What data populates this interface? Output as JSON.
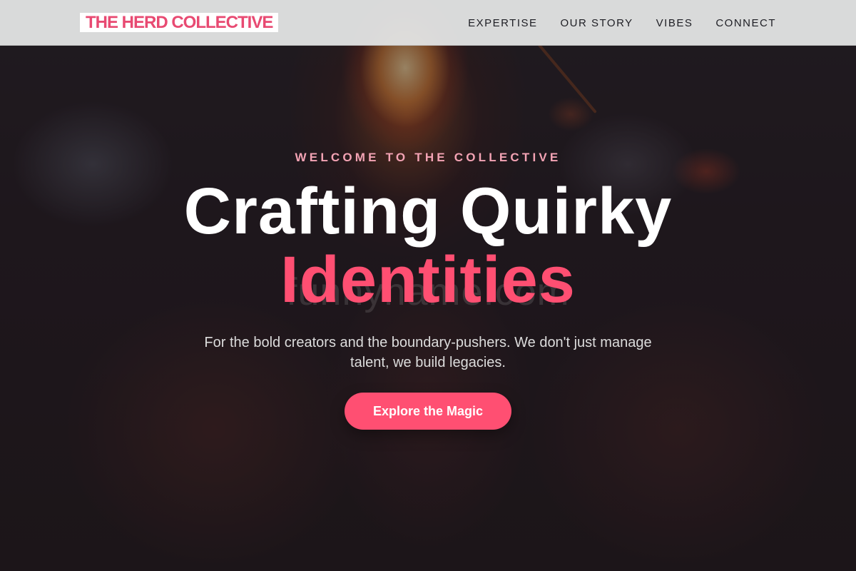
{
  "nav": {
    "logo": "THE HERD COLLECTIVE",
    "links": [
      "EXPERTISE",
      "OUR STORY",
      "VIBES",
      "CONNECT"
    ]
  },
  "hero": {
    "eyebrow": "WELCOME TO THE COLLECTIVE",
    "headline_line1": "Crafting Quirky",
    "headline_line2": "Identities",
    "subtext": "For the bold creators and the boundary-pushers. We don't just manage talent, we build legacies.",
    "cta_label": "Explore the Magic",
    "watermark": "funnyname.com"
  },
  "colors": {
    "accent": "#ff4f72",
    "logo_text": "#e84a72",
    "eyebrow": "#f3a3b4",
    "navbar_bg": "#e1e2e2"
  }
}
